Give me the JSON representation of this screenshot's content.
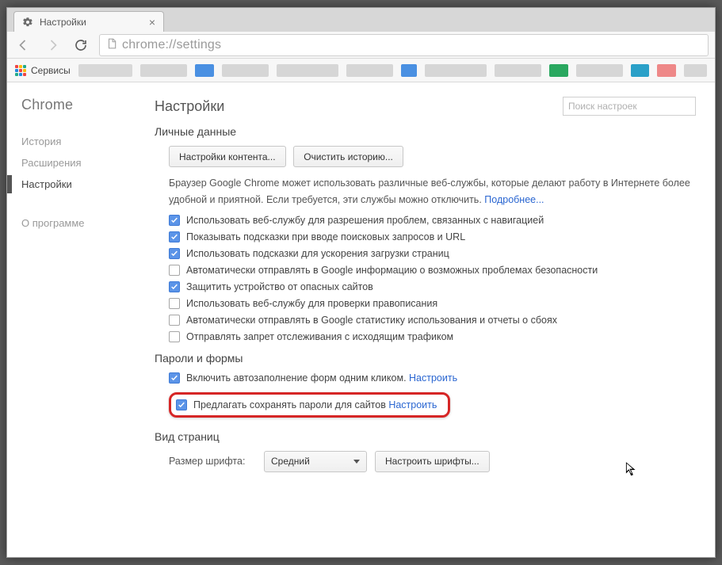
{
  "tab": {
    "title": "Настройки"
  },
  "omnibox": {
    "url": "chrome://settings"
  },
  "bookmarks": {
    "apps_label": "Сервисы"
  },
  "sidebar": {
    "brand": "Chrome",
    "items": [
      {
        "label": "История"
      },
      {
        "label": "Расширения"
      },
      {
        "label": "Настройки"
      },
      {
        "label": "О программе"
      }
    ]
  },
  "page": {
    "title": "Настройки",
    "search_placeholder": "Поиск настроек"
  },
  "personal": {
    "title": "Личные данные",
    "content_settings_btn": "Настройки контента...",
    "clear_history_btn": "Очистить историю...",
    "desc1": "Браузер Google Chrome может использовать различные веб-службы, которые делают работу в Интернете более удобной и приятной. Если требуется, эти службы можно отключить. ",
    "desc_more": "Подробнее...",
    "checks": [
      {
        "label": "Использовать веб-службу для разрешения проблем, связанных с навигацией",
        "checked": true
      },
      {
        "label": "Показывать подсказки при вводе поисковых запросов и URL",
        "checked": true
      },
      {
        "label": "Использовать подсказки для ускорения загрузки страниц",
        "checked": true
      },
      {
        "label": "Автоматически отправлять в Google информацию о возможных проблемах безопасности",
        "checked": false
      },
      {
        "label": "Защитить устройство от опасных сайтов",
        "checked": true
      },
      {
        "label": "Использовать веб-службу для проверки правописания",
        "checked": false
      },
      {
        "label": "Автоматически отправлять в Google статистику использования и отчеты о сбоях",
        "checked": false
      },
      {
        "label": "Отправлять запрет отслеживания с исходящим трафиком",
        "checked": false
      }
    ]
  },
  "passwords": {
    "title": "Пароли и формы",
    "autofill_row": {
      "label": "Включить автозаполнение форм одним кликом. ",
      "configure": "Настроить",
      "checked": true
    },
    "save_pw_row": {
      "label": "Предлагать сохранять пароли для сайтов ",
      "configure": "Настроить",
      "checked": true
    }
  },
  "view": {
    "title": "Вид страниц",
    "font_label": "Размер шрифта:",
    "font_value": "Средний",
    "font_btn": "Настроить шрифты..."
  }
}
